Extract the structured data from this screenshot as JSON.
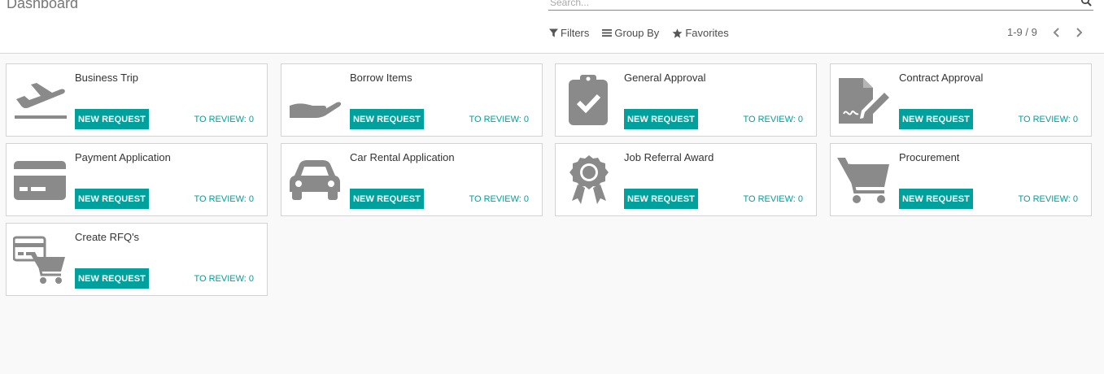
{
  "breadcrumb": {
    "title": "Dashboard"
  },
  "search": {
    "placeholder": "Search...",
    "value": ""
  },
  "filters": {
    "filters_label": "Filters",
    "group_by_label": "Group By",
    "favorites_label": "Favorites"
  },
  "pager": {
    "text": "1-9 / 9"
  },
  "colors": {
    "accent": "#00a09d",
    "icon": "#8a8a8a"
  },
  "cards": [
    {
      "title": "Business Trip",
      "icon": "plane-departure-icon",
      "button": "NEW REQUEST",
      "review": "TO REVIEW: 0"
    },
    {
      "title": "Borrow Items",
      "icon": "hand-open-icon",
      "button": "NEW REQUEST",
      "review": "TO REVIEW: 0"
    },
    {
      "title": "General Approval",
      "icon": "clipboard-check-icon",
      "button": "NEW REQUEST",
      "review": "TO REVIEW: 0"
    },
    {
      "title": "Contract Approval",
      "icon": "file-signature-icon",
      "button": "NEW REQUEST",
      "review": "TO REVIEW: 0"
    },
    {
      "title": "Payment Application",
      "icon": "credit-card-icon",
      "button": "NEW REQUEST",
      "review": "TO REVIEW: 0"
    },
    {
      "title": "Car Rental Application",
      "icon": "car-icon",
      "button": "NEW REQUEST",
      "review": "TO REVIEW: 0"
    },
    {
      "title": "Job Referral Award",
      "icon": "award-icon",
      "button": "NEW REQUEST",
      "review": "TO REVIEW: 0"
    },
    {
      "title": "Procurement",
      "icon": "shopping-cart-icon",
      "button": "NEW REQUEST",
      "review": "TO REVIEW: 0"
    },
    {
      "title": "Create RFQ's",
      "icon": "card-cart-icon",
      "button": "NEW REQUEST",
      "review": "TO REVIEW: 0"
    }
  ]
}
